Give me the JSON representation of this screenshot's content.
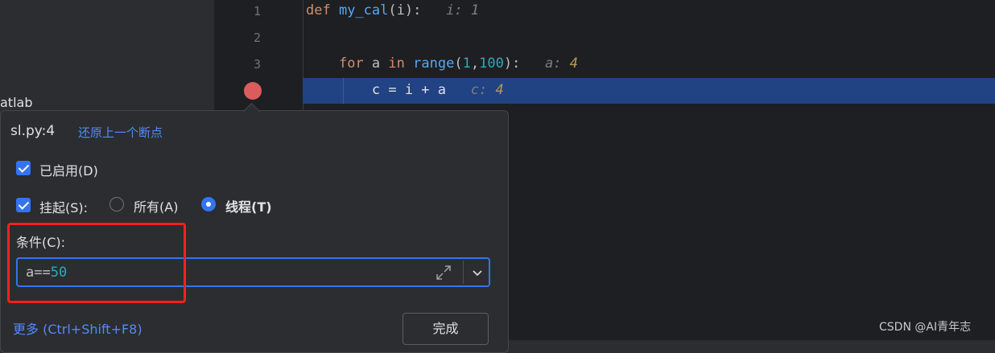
{
  "left_panel": {
    "partial_text": "atlab"
  },
  "editor": {
    "line_numbers": [
      "1",
      "2",
      "3"
    ],
    "lines": [
      {
        "kw": "def",
        "name": "my_cal",
        "open": "(",
        "param": "i",
        "close": "):",
        "hint_label": "i:",
        "hint_value": "1"
      },
      {},
      {
        "kw": "for",
        "var": "a",
        "kw2": "in",
        "builtin": "range",
        "open": "(",
        "arg1": "1",
        "comma": ",",
        "arg2": "100",
        "close": "):",
        "hint_label": "a:",
        "hint_value": "4"
      },
      {
        "text": "c = i + a",
        "hint_label": "c:",
        "hint_value": "4"
      }
    ]
  },
  "popup": {
    "title": "sl.py:4",
    "restore_link": "还原上一个断点",
    "enabled_label": "已启用(D)",
    "suspend_label": "挂起(S):",
    "radio_all": "所有(A)",
    "radio_thread": "线程(T)",
    "condition_label": "条件(C):",
    "condition_value_prefix": "a==",
    "condition_value_num": "50",
    "more_link": "更多 (Ctrl+Shift+F8)",
    "done_button": "完成"
  },
  "watermark": "CSDN @AI青年志",
  "colors": {
    "accent": "#3574f0",
    "current_line": "#214283",
    "breakpoint": "#db5c5c",
    "highlight_box": "#ff1e1e"
  },
  "state": {
    "enabled_checked": true,
    "suspend_checked": true,
    "selected_radio": "thread"
  }
}
